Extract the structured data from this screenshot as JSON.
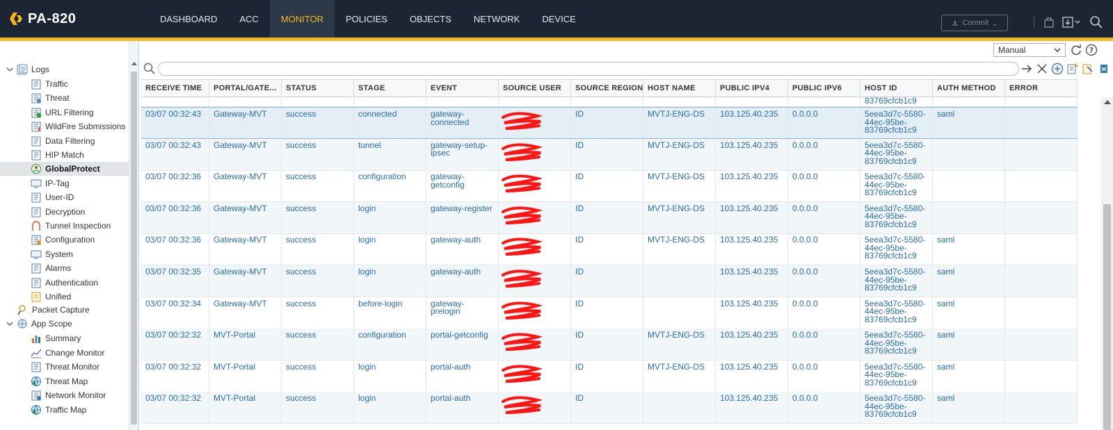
{
  "app": {
    "title": "PA-820",
    "brand_color": "#f4b81c",
    "topbar_color": "#1c2533"
  },
  "nav": {
    "tabs": [
      {
        "label": "DASHBOARD",
        "active": false
      },
      {
        "label": "ACC",
        "active": false
      },
      {
        "label": "MONITOR",
        "active": true
      },
      {
        "label": "POLICIES",
        "active": false
      },
      {
        "label": "OBJECTS",
        "active": false
      },
      {
        "label": "NETWORK",
        "active": false
      },
      {
        "label": "DEVICE",
        "active": false
      }
    ],
    "commit_label": "Commit",
    "right_icons": [
      "lock-icon",
      "save-config-icon",
      "search-icon"
    ]
  },
  "sidebar": {
    "logs_label": "Logs",
    "items": [
      {
        "label": "Traffic",
        "icon": "log-icon"
      },
      {
        "label": "Threat",
        "icon": "threat-log-icon"
      },
      {
        "label": "URL Filtering",
        "icon": "url-filter-icon"
      },
      {
        "label": "WildFire Submissions",
        "icon": "wildfire-icon"
      },
      {
        "label": "Data Filtering",
        "icon": "log-icon"
      },
      {
        "label": "HIP Match",
        "icon": "log-icon"
      },
      {
        "label": "GlobalProtect",
        "icon": "globalprotect-icon",
        "selected": true
      },
      {
        "label": "IP-Tag",
        "icon": "monitor-icon"
      },
      {
        "label": "User-ID",
        "icon": "log-icon"
      },
      {
        "label": "Decryption",
        "icon": "log-icon"
      },
      {
        "label": "Tunnel Inspection",
        "icon": "tunnel-icon"
      },
      {
        "label": "Configuration",
        "icon": "config-icon"
      },
      {
        "label": "System",
        "icon": "monitor-icon"
      },
      {
        "label": "Alarms",
        "icon": "log-icon"
      },
      {
        "label": "Authentication",
        "icon": "log-icon"
      },
      {
        "label": "Unified",
        "icon": "unified-icon"
      }
    ],
    "packet_capture_label": "Packet Capture",
    "app_scope_label": "App Scope",
    "app_scope_items": [
      {
        "label": "Summary",
        "icon": "bar-chart-icon"
      },
      {
        "label": "Change Monitor",
        "icon": "line-chart-icon"
      },
      {
        "label": "Threat Monitor",
        "icon": "threat-monitor-icon"
      },
      {
        "label": "Threat Map",
        "icon": "globe-icon"
      },
      {
        "label": "Network Monitor",
        "icon": "network-monitor-icon"
      },
      {
        "label": "Traffic Map",
        "icon": "globe-icon"
      }
    ]
  },
  "toolbar": {
    "refresh_mode": "Manual",
    "search_placeholder": "",
    "icons": [
      "refresh-icon",
      "help-icon",
      "apply-filter-icon",
      "clear-filter-icon",
      "add-filter-icon",
      "save-filter-icon",
      "load-filter-icon",
      "export-icon"
    ]
  },
  "table": {
    "columns": [
      "RECEIVE TIME",
      "PORTAL/GATE...",
      "STATUS",
      "STAGE",
      "EVENT",
      "SOURCE USER",
      "SOURCE REGION",
      "HOST NAME",
      "PUBLIC IPV4",
      "PUBLIC IPV6",
      "HOST ID",
      "AUTH METHOD",
      "ERROR"
    ],
    "partial_top_host_id": "83769cfcb1c9",
    "rows": [
      {
        "time": "03/07 00:32:43",
        "portal": "Gateway-MVT",
        "status": "success",
        "stage": "connected",
        "event": "gateway-connected",
        "region": "ID",
        "host": "MVTJ-ENG-DS",
        "ipv4": "103.125.40.235",
        "ipv6": "0.0.0.0",
        "host_id": "5eea3d7c-5580-44ec-95be-83769cfcb1c9",
        "auth": "saml",
        "error": ""
      },
      {
        "time": "03/07 00:32:43",
        "portal": "Gateway-MVT",
        "status": "success",
        "stage": "tunnel",
        "event": "gateway-setup-ipsec",
        "region": "ID",
        "host": "MVTJ-ENG-DS",
        "ipv4": "103.125.40.235",
        "ipv6": "0.0.0.0",
        "host_id": "5eea3d7c-5580-44ec-95be-83769cfcb1c9",
        "auth": "",
        "error": ""
      },
      {
        "time": "03/07 00:32:36",
        "portal": "Gateway-MVT",
        "status": "success",
        "stage": "configuration",
        "event": "gateway-getconfig",
        "region": "ID",
        "host": "MVTJ-ENG-DS",
        "ipv4": "103.125.40.235",
        "ipv6": "0.0.0.0",
        "host_id": "5eea3d7c-5580-44ec-95be-83769cfcb1c9",
        "auth": "",
        "error": ""
      },
      {
        "time": "03/07 00:32:36",
        "portal": "Gateway-MVT",
        "status": "success",
        "stage": "login",
        "event": "gateway-register",
        "region": "ID",
        "host": "MVTJ-ENG-DS",
        "ipv4": "103.125.40.235",
        "ipv6": "0.0.0.0",
        "host_id": "5eea3d7c-5580-44ec-95be-83769cfcb1c9",
        "auth": "",
        "error": ""
      },
      {
        "time": "03/07 00:32:36",
        "portal": "Gateway-MVT",
        "status": "success",
        "stage": "login",
        "event": "gateway-auth",
        "region": "ID",
        "host": "MVTJ-ENG-DS",
        "ipv4": "103.125.40.235",
        "ipv6": "0.0.0.0",
        "host_id": "5eea3d7c-5580-44ec-95be-83769cfcb1c9",
        "auth": "saml",
        "error": ""
      },
      {
        "time": "03/07 00:32:35",
        "portal": "Gateway-MVT",
        "status": "success",
        "stage": "login",
        "event": "gateway-auth",
        "region": "ID",
        "host": "",
        "ipv4": "103.125.40.235",
        "ipv6": "0.0.0.0",
        "host_id": "5eea3d7c-5580-44ec-95be-83769cfcb1c9",
        "auth": "saml",
        "error": ""
      },
      {
        "time": "03/07 00:32:34",
        "portal": "Gateway-MVT",
        "status": "success",
        "stage": "before-login",
        "event": "gateway-prelogin",
        "region": "ID",
        "host": "",
        "ipv4": "103.125.40.235",
        "ipv6": "0.0.0.0",
        "host_id": "5eea3d7c-5580-44ec-95be-83769cfcb1c9",
        "auth": "saml",
        "error": ""
      },
      {
        "time": "03/07 00:32:32",
        "portal": "MVT-Portal",
        "status": "success",
        "stage": "configuration",
        "event": "portal-getconfig",
        "region": "ID",
        "host": "MVTJ-ENG-DS",
        "ipv4": "103.125.40.235",
        "ipv6": "0.0.0.0",
        "host_id": "5eea3d7c-5580-44ec-95be-83769cfcb1c9",
        "auth": "saml",
        "error": ""
      },
      {
        "time": "03/07 00:32:32",
        "portal": "MVT-Portal",
        "status": "success",
        "stage": "login",
        "event": "portal-auth",
        "region": "ID",
        "host": "MVTJ-ENG-DS",
        "ipv4": "103.125.40.235",
        "ipv6": "0.0.0.0",
        "host_id": "5eea3d7c-5580-44ec-95be-83769cfcb1c9",
        "auth": "saml",
        "error": ""
      },
      {
        "time": "03/07 00:32:32",
        "portal": "MVT-Portal",
        "status": "success",
        "stage": "login",
        "event": "portal-auth",
        "region": "ID",
        "host": "",
        "ipv4": "103.125.40.235",
        "ipv6": "0.0.0.0",
        "host_id": "5eea3d7c-5580-44ec-95be-83769cfcb1c9",
        "auth": "saml",
        "error": ""
      }
    ]
  }
}
